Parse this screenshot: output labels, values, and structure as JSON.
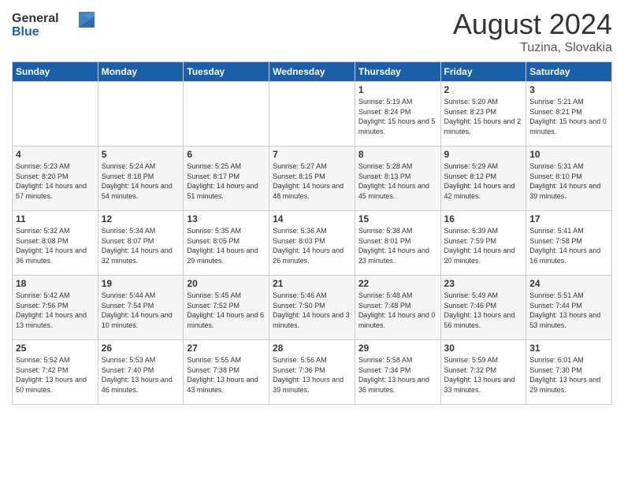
{
  "header": {
    "logo": {
      "line1": "General",
      "line2": "Blue"
    },
    "month_year": "August 2024",
    "location": "Tuzina, Slovakia"
  },
  "weekdays": [
    "Sunday",
    "Monday",
    "Tuesday",
    "Wednesday",
    "Thursday",
    "Friday",
    "Saturday"
  ],
  "weeks": [
    [
      {
        "day": "",
        "info": ""
      },
      {
        "day": "",
        "info": ""
      },
      {
        "day": "",
        "info": ""
      },
      {
        "day": "",
        "info": ""
      },
      {
        "day": "1",
        "info": "Sunrise: 5:19 AM\nSunset: 8:24 PM\nDaylight: 15 hours\nand 5 minutes."
      },
      {
        "day": "2",
        "info": "Sunrise: 5:20 AM\nSunset: 8:23 PM\nDaylight: 15 hours\nand 2 minutes."
      },
      {
        "day": "3",
        "info": "Sunrise: 5:21 AM\nSunset: 8:21 PM\nDaylight: 15 hours\nand 0 minutes."
      }
    ],
    [
      {
        "day": "4",
        "info": "Sunrise: 5:23 AM\nSunset: 8:20 PM\nDaylight: 14 hours\nand 57 minutes."
      },
      {
        "day": "5",
        "info": "Sunrise: 5:24 AM\nSunset: 8:18 PM\nDaylight: 14 hours\nand 54 minutes."
      },
      {
        "day": "6",
        "info": "Sunrise: 5:25 AM\nSunset: 8:17 PM\nDaylight: 14 hours\nand 51 minutes."
      },
      {
        "day": "7",
        "info": "Sunrise: 5:27 AM\nSunset: 8:15 PM\nDaylight: 14 hours\nand 48 minutes."
      },
      {
        "day": "8",
        "info": "Sunrise: 5:28 AM\nSunset: 8:13 PM\nDaylight: 14 hours\nand 45 minutes."
      },
      {
        "day": "9",
        "info": "Sunrise: 5:29 AM\nSunset: 8:12 PM\nDaylight: 14 hours\nand 42 minutes."
      },
      {
        "day": "10",
        "info": "Sunrise: 5:31 AM\nSunset: 8:10 PM\nDaylight: 14 hours\nand 39 minutes."
      }
    ],
    [
      {
        "day": "11",
        "info": "Sunrise: 5:32 AM\nSunset: 8:08 PM\nDaylight: 14 hours\nand 36 minutes."
      },
      {
        "day": "12",
        "info": "Sunrise: 5:34 AM\nSunset: 8:07 PM\nDaylight: 14 hours\nand 32 minutes."
      },
      {
        "day": "13",
        "info": "Sunrise: 5:35 AM\nSunset: 8:05 PM\nDaylight: 14 hours\nand 29 minutes."
      },
      {
        "day": "14",
        "info": "Sunrise: 5:36 AM\nSunset: 8:03 PM\nDaylight: 14 hours\nand 26 minutes."
      },
      {
        "day": "15",
        "info": "Sunrise: 5:38 AM\nSunset: 8:01 PM\nDaylight: 14 hours\nand 23 minutes."
      },
      {
        "day": "16",
        "info": "Sunrise: 5:39 AM\nSunset: 7:59 PM\nDaylight: 14 hours\nand 20 minutes."
      },
      {
        "day": "17",
        "info": "Sunrise: 5:41 AM\nSunset: 7:58 PM\nDaylight: 14 hours\nand 16 minutes."
      }
    ],
    [
      {
        "day": "18",
        "info": "Sunrise: 5:42 AM\nSunset: 7:56 PM\nDaylight: 14 hours\nand 13 minutes."
      },
      {
        "day": "19",
        "info": "Sunrise: 5:44 AM\nSunset: 7:54 PM\nDaylight: 14 hours\nand 10 minutes."
      },
      {
        "day": "20",
        "info": "Sunrise: 5:45 AM\nSunset: 7:52 PM\nDaylight: 14 hours\nand 6 minutes."
      },
      {
        "day": "21",
        "info": "Sunrise: 5:46 AM\nSunset: 7:50 PM\nDaylight: 14 hours\nand 3 minutes."
      },
      {
        "day": "22",
        "info": "Sunrise: 5:48 AM\nSunset: 7:48 PM\nDaylight: 14 hours\nand 0 minutes."
      },
      {
        "day": "23",
        "info": "Sunrise: 5:49 AM\nSunset: 7:46 PM\nDaylight: 13 hours\nand 56 minutes."
      },
      {
        "day": "24",
        "info": "Sunrise: 5:51 AM\nSunset: 7:44 PM\nDaylight: 13 hours\nand 53 minutes."
      }
    ],
    [
      {
        "day": "25",
        "info": "Sunrise: 5:52 AM\nSunset: 7:42 PM\nDaylight: 13 hours\nand 50 minutes."
      },
      {
        "day": "26",
        "info": "Sunrise: 5:53 AM\nSunset: 7:40 PM\nDaylight: 13 hours\nand 46 minutes."
      },
      {
        "day": "27",
        "info": "Sunrise: 5:55 AM\nSunset: 7:38 PM\nDaylight: 13 hours\nand 43 minutes."
      },
      {
        "day": "28",
        "info": "Sunrise: 5:56 AM\nSunset: 7:36 PM\nDaylight: 13 hours\nand 39 minutes."
      },
      {
        "day": "29",
        "info": "Sunrise: 5:58 AM\nSunset: 7:34 PM\nDaylight: 13 hours\nand 36 minutes."
      },
      {
        "day": "30",
        "info": "Sunrise: 5:59 AM\nSunset: 7:32 PM\nDaylight: 13 hours\nand 33 minutes."
      },
      {
        "day": "31",
        "info": "Sunrise: 6:01 AM\nSunset: 7:30 PM\nDaylight: 13 hours\nand 29 minutes."
      }
    ]
  ]
}
